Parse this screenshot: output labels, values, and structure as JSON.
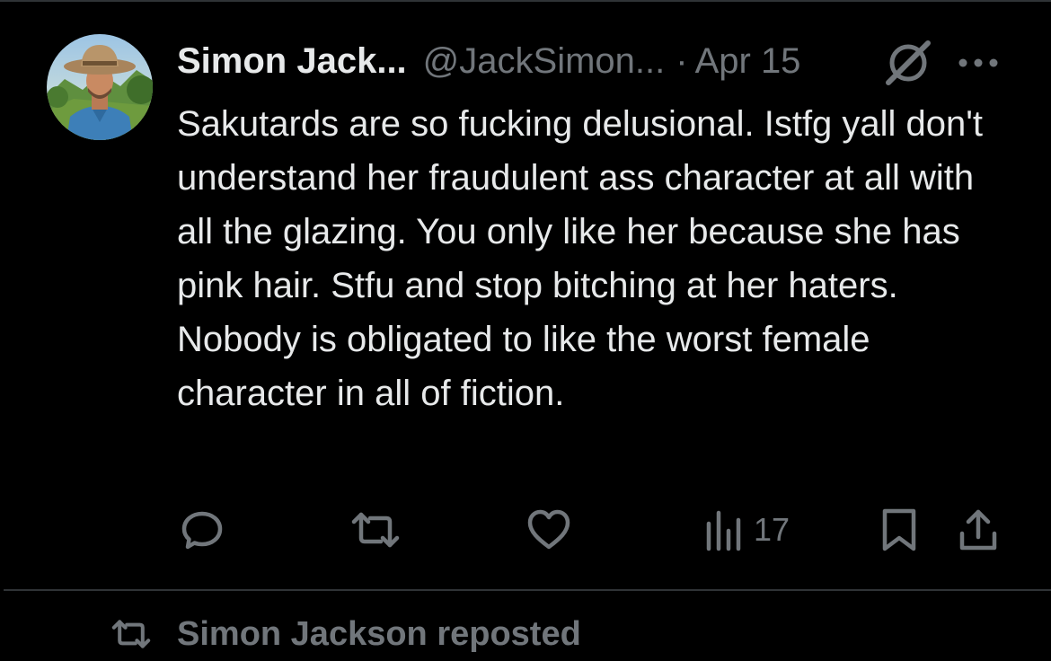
{
  "tweet": {
    "display_name": "Simon Jack...",
    "handle": "@JackSimon...",
    "separator": "·",
    "date": "Apr 15",
    "text": "Sakutards are so fucking delusional. Istfg yall don't understand her fraudulent ass character at all with all the glazing. You only like her because she has pink hair. Stfu and stop bitching at her haters. Nobody is obligated to like the worst female character in all of fiction.",
    "avatar_icon": "avatar-cowboy-photo",
    "header_icons": [
      "grok-icon",
      "more-icon"
    ]
  },
  "actions": {
    "reply_icon": "reply-icon",
    "repost_icon": "repost-icon",
    "like_icon": "like-icon",
    "views_icon": "views-icon",
    "views_count": "17",
    "bookmark_icon": "bookmark-icon",
    "share_icon": "share-icon"
  },
  "next_item": {
    "repost_label": "Simon Jackson reposted",
    "icon": "repost-icon"
  },
  "colors": {
    "background": "#000000",
    "primary_text": "#e7e9ea",
    "secondary_text": "#71767b",
    "divider": "#2f3336"
  }
}
